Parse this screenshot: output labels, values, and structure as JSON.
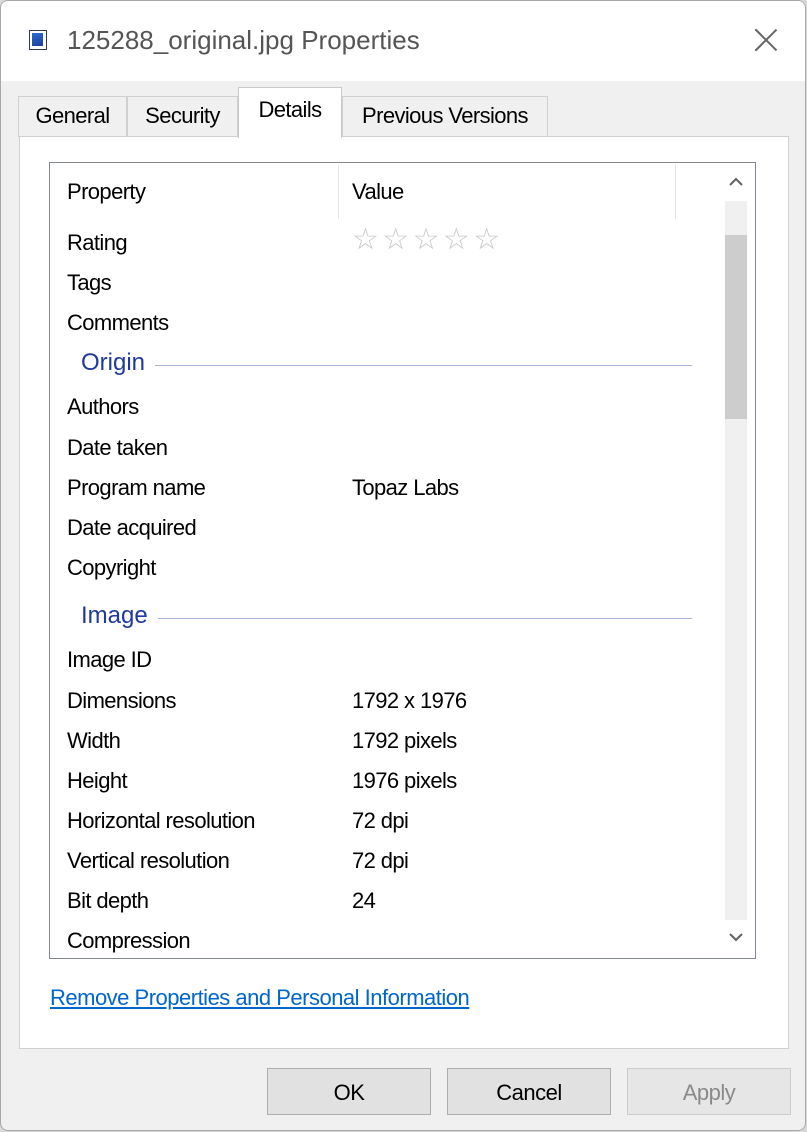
{
  "window": {
    "title": "125288_original.jpg Properties"
  },
  "tabs": [
    {
      "label": "General"
    },
    {
      "label": "Security"
    },
    {
      "label": "Details"
    },
    {
      "label": "Previous Versions"
    }
  ],
  "details": {
    "columns": {
      "property": "Property",
      "value": "Value"
    },
    "rating": {
      "label": "Rating",
      "stars": 0,
      "max": 5,
      "glyph": "☆"
    },
    "rows_top": [
      {
        "key": "Tags",
        "value": ""
      },
      {
        "key": "Comments",
        "value": ""
      }
    ],
    "origin": {
      "heading": "Origin",
      "rows": [
        {
          "key": "Authors",
          "value": ""
        },
        {
          "key": "Date taken",
          "value": ""
        },
        {
          "key": "Program name",
          "value": "Topaz Labs"
        },
        {
          "key": "Date acquired",
          "value": ""
        },
        {
          "key": "Copyright",
          "value": ""
        }
      ]
    },
    "image": {
      "heading": "Image",
      "rows": [
        {
          "key": "Image ID",
          "value": ""
        },
        {
          "key": "Dimensions",
          "value": "1792 x 1976"
        },
        {
          "key": "Width",
          "value": "1792 pixels"
        },
        {
          "key": "Height",
          "value": "1976 pixels"
        },
        {
          "key": "Horizontal resolution",
          "value": "72 dpi"
        },
        {
          "key": "Vertical resolution",
          "value": "72 dpi"
        },
        {
          "key": "Bit depth",
          "value": "24"
        },
        {
          "key": "Compression",
          "value": ""
        }
      ]
    }
  },
  "link": {
    "label": "Remove Properties and Personal Information"
  },
  "buttons": {
    "ok": "OK",
    "cancel": "Cancel",
    "apply": "Apply"
  },
  "colors": {
    "accent_link": "#0066cc",
    "group_heading": "#1e3a9c"
  }
}
